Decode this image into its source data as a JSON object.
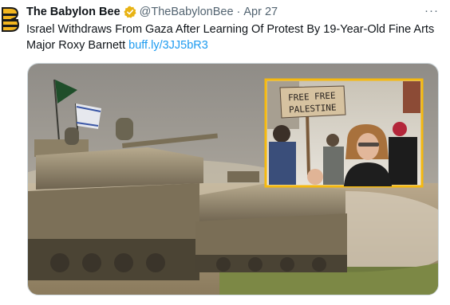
{
  "author": {
    "name": "The Babylon Bee",
    "handle": "@TheBabylonBee",
    "separator": "·",
    "date": "Apr 27",
    "avatar_icon": "babylon-bee-logo-icon",
    "verified_icon": "gold-verified-badge-icon"
  },
  "tweet": {
    "text": "Israel Withdraws From Gaza After Learning Of Protest By 19-Year-Old Fine Arts Major Roxy Barnett",
    "link": "buff.ly/3JJ5bR3"
  },
  "more_icon": "more-options-icon",
  "more_label": "···",
  "media": {
    "sign_text": [
      "FREE FREE",
      "PALESTINE"
    ],
    "inset_border_color": "#f5b90f"
  },
  "colors": {
    "link": "#1d9bf0",
    "secondary_text": "#536471",
    "verified_gold": "#e8b314"
  }
}
